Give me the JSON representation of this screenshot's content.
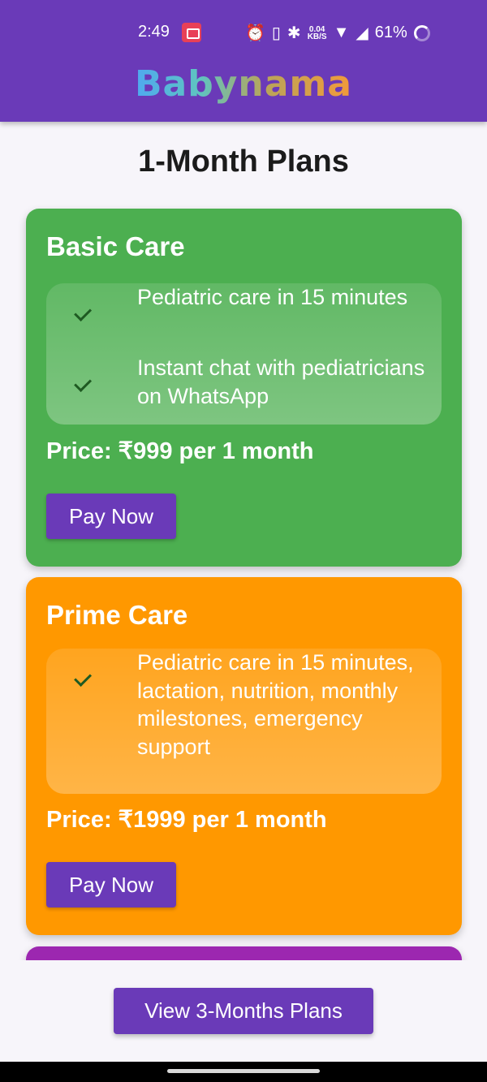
{
  "status_bar": {
    "time": "2:49",
    "net_speed_value": "0.04",
    "net_speed_unit": "KB/S",
    "battery": "61%",
    "icons": [
      "screen-record-icon",
      "alarm-icon",
      "vibrate-icon",
      "bluetooth-icon",
      "wifi-icon",
      "signal-icon",
      "battery-icon"
    ]
  },
  "app_bar": {
    "logo": "Babynama",
    "color": "#6a3ab8"
  },
  "page": {
    "title": "1-Month Plans"
  },
  "plans": [
    {
      "name": "Basic Care",
      "color": "#4caf50",
      "features": [
        "Pediatric care in 15 minutes",
        "Instant chat with pediatricians on WhatsApp"
      ],
      "price": "Price: ₹999 per 1 month",
      "button": "Pay Now"
    },
    {
      "name": "Prime Care",
      "color": "#ff9800",
      "features": [
        "Pediatric care in 15 minutes, lactation, nutrition, monthly milestones, emergency support"
      ],
      "price": "Price: ₹1999 per 1 month",
      "button": "Pay Now"
    },
    {
      "color": "#9c27b0"
    }
  ],
  "footer": {
    "view_button": "View 3-Months Plans"
  }
}
